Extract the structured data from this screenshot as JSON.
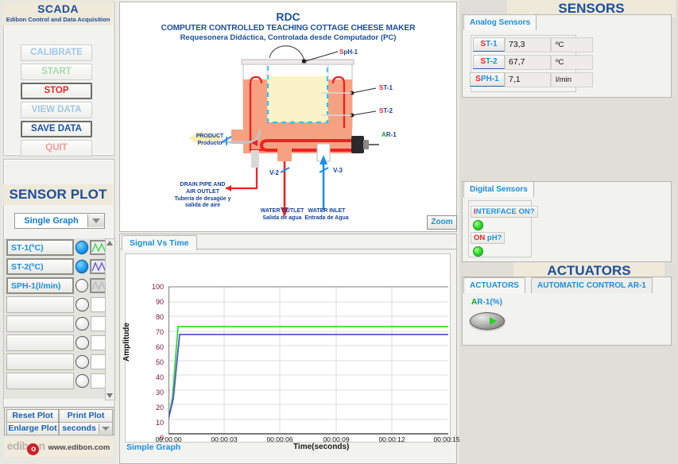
{
  "left": {
    "scada_title": "SCADA",
    "scada_subtitle": "Edibon Control and Data Acquisition",
    "buttons": [
      {
        "label": "CALIBRATE",
        "state": "disabled"
      },
      {
        "label": "START",
        "state": "disabled"
      },
      {
        "label": "STOP",
        "state": "active"
      },
      {
        "label": "VIEW DATA",
        "state": "disabled"
      },
      {
        "label": "SAVE DATA",
        "state": "active"
      },
      {
        "label": "QUIT",
        "state": "disabled"
      }
    ],
    "sensor_plot_title": "SENSOR PLOT",
    "graph_mode": "Single Graph",
    "sensor_rows": [
      {
        "label": "ST-1(ºC)",
        "selected": true
      },
      {
        "label": "ST-2(ºC)",
        "selected": true
      },
      {
        "label": "SPH-1(l/min)",
        "selected": false
      },
      {
        "label": "",
        "selected": false
      },
      {
        "label": "",
        "selected": false
      },
      {
        "label": "",
        "selected": false
      },
      {
        "label": "",
        "selected": false
      },
      {
        "label": "",
        "selected": false
      }
    ],
    "plot_buttons": {
      "reset": "Reset Plot",
      "print": "Print Plot",
      "enlarge": "Enlarge Plot",
      "units": "seconds"
    },
    "footer": {
      "logo": "edibon",
      "url": "www.edibon.com"
    }
  },
  "diagram": {
    "code": "RDC",
    "title_en": "COMPUTER CONTROLLED TEACHING COTTAGE CHEESE MAKER",
    "title_es": "Requesonera Didáctica, Controlada desde Computador (PC)",
    "zoom_button": "Zoom",
    "tags": {
      "sph1": {
        "s": "S",
        "rest": "pH-1"
      },
      "st1": {
        "s": "S",
        "rest": "T-1"
      },
      "st2": {
        "s": "S",
        "rest": "T-2"
      },
      "ar1": {
        "a": "A",
        "rest": "R-1"
      }
    },
    "labels": {
      "product_en": "PRODUCT",
      "product_es": "Producto",
      "drain_en_1": "DRAIN PIPE AND",
      "drain_en_2": "AIR OUTLET",
      "drain_es_1": "Tubería de desagüe y",
      "drain_es_2": "salida de aire",
      "water_outlet_en": "WATER OUTLET",
      "water_outlet_es": "Salida de agua",
      "water_inlet_en": "WATER INLET",
      "water_inlet_es": "Entrada de Agua",
      "v2": "V-2",
      "v3": "V-3"
    }
  },
  "chart_panel": {
    "tab": "Signal Vs Time",
    "footer_left": "Simple Graph"
  },
  "chart_data": {
    "type": "line",
    "title": "",
    "xlabel": "Time(seconds)",
    "ylabel": "Amplitude",
    "ylim": [
      0,
      100
    ],
    "yticks": [
      0,
      10,
      20,
      30,
      40,
      50,
      60,
      70,
      80,
      90,
      100
    ],
    "xticks": [
      "00:00:00",
      "00:00:03",
      "00:00:06",
      "00:00:09",
      "00:00:12",
      "00:00:15"
    ],
    "xlim_seconds": [
      0,
      15
    ],
    "grid": true,
    "legend": "none",
    "series": [
      {
        "name": "ST-1(ºC)",
        "color": "#33dd33",
        "x": [
          0.0,
          0.25,
          0.55,
          15.0
        ],
        "values": [
          10.0,
          40.0,
          73.3,
          73.3
        ]
      },
      {
        "name": "ST-2(ºC)",
        "color": "#5b53d8",
        "x": [
          0.0,
          0.25,
          0.6,
          15.0
        ],
        "values": [
          10.0,
          38.0,
          67.7,
          67.7
        ]
      }
    ]
  },
  "sensors": {
    "heading": "SENSORS",
    "analog_tab": "Analog Sensors",
    "analog_rows": [
      {
        "tag_s": "S",
        "tag_rest": "T-1",
        "value": "73,3",
        "unit": "ºC"
      },
      {
        "tag_s": "S",
        "tag_rest": "T-2",
        "value": "67,7",
        "unit": "ºC"
      },
      {
        "tag_s": "S",
        "tag_rest": "PH-1",
        "value": "7,1",
        "unit": "l/min"
      }
    ],
    "digital_tab": "Digital Sensors",
    "digital_rows": [
      {
        "red": "I",
        "blue": "NTERFACE ON?",
        "state": "on"
      },
      {
        "red": "ON",
        "blue": " pH?",
        "state": "on"
      }
    ]
  },
  "actuators": {
    "heading": "ACTUATORS",
    "tab_active": "ACTUATORS",
    "tab_inactive": "AUTOMATIC CONTROL AR-1",
    "ar1_label_a": "A",
    "ar1_label_rest": "R-1(%)"
  },
  "colors": {
    "brand_blue": "#1b4f9c",
    "link_blue": "#1c8fe0",
    "red": "#ee2222",
    "green": "#13a313",
    "band": "#efe9da",
    "series_green": "#33dd33",
    "series_blue": "#5b53d8"
  }
}
